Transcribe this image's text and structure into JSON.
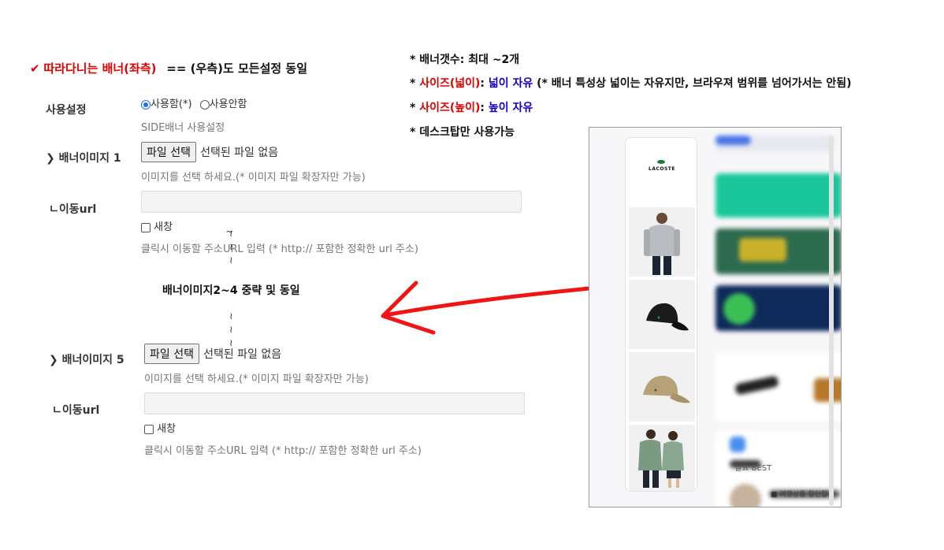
{
  "section": {
    "check_icon": "✔",
    "title": "따라다니는 배너(좌측)",
    "subtitle": "== (우측)도 모든설정 동일"
  },
  "use_setting": {
    "label": "사용설정",
    "option_on": "사용함(*)",
    "option_off": "사용안함",
    "selected": "사용함(*)",
    "help": "SIDE배너 사용설정"
  },
  "banner1": {
    "label": "배너이미지 1",
    "file_button": "파일 선택",
    "file_status": "선택된 파일 없음",
    "file_help": "이미지를 선택 하세요.(* 이미지 파일 확장자만 가능)",
    "url_label": "ㄴ이동url",
    "url_value": "",
    "new_window": "새창",
    "url_help": "클릭시 이동할 주소URL 입력 (* http:// 포함한 정확한 url 주소)"
  },
  "omitted_text": "배너이미지2~4 중략 및 동일",
  "squiggle": "≀",
  "banner5": {
    "label": "배너이미지 5",
    "file_button": "파일 선택",
    "file_status": "선택된 파일 없음",
    "file_help": "이미지를 선택 하세요.(* 이미지 파일 확장자만 가능)",
    "url_label": "ㄴ이동url",
    "url_value": "",
    "new_window": "새창",
    "url_help": "클릭시 이동할 주소URL 입력 (* http:// 포함한 정확한 url 주소)"
  },
  "chevron_icon": "❯",
  "notes": {
    "count": "* 배너갯수: 최대 ~2개",
    "width_prefix": "* ",
    "width_key": "사이즈(넓이)",
    "width_colon": ": ",
    "width_value": "넓이 자유",
    "width_tail": " (* 배너 특성상 넓이는 자유지만, 브라우져 범위를 넘어가서는 안됨)",
    "height_prefix": "* ",
    "height_key": "사이즈(높이)",
    "height_colon": ": ",
    "height_value": "높이 자유",
    "desktop": "* 데스크탑만 사용가능"
  },
  "preview": {
    "brand_logo_text": "LACOSTE",
    "blurred_label": "필요 BEST",
    "blurred_caption": "■ 여행상품 할인할레"
  },
  "colors": {
    "red": "#e00000",
    "blue": "#1000c8",
    "arrow": "#f01414"
  }
}
